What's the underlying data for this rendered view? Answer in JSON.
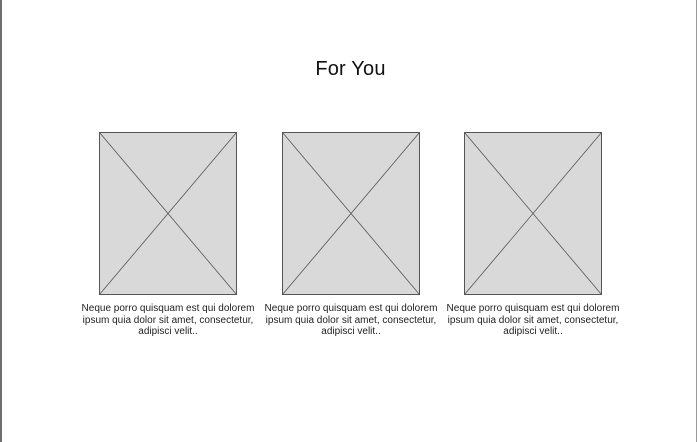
{
  "header": {
    "title": "For You"
  },
  "cards": [
    {
      "caption": "Neque porro quisquam est qui dolorem ipsum quia dolor sit amet, consectetur, adipisci velit.."
    },
    {
      "caption": "Neque porro quisquam est qui dolorem ipsum quia dolor sit amet, consectetur, adipisci velit.."
    },
    {
      "caption": "Neque porro quisquam est qui dolorem ipsum quia dolor sit amet, consectetur, adipisci velit.."
    }
  ],
  "colors": {
    "placeholder_fill": "#d9d9d9",
    "placeholder_stroke": "#555555",
    "text": "#222222"
  }
}
